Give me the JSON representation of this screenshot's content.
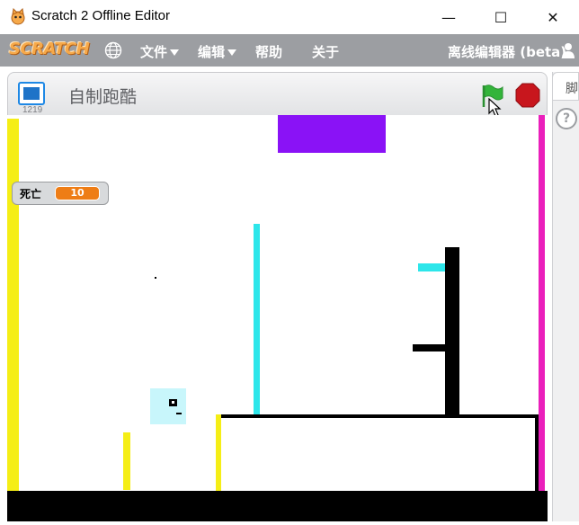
{
  "window": {
    "title": "Scratch 2 Offline Editor",
    "minimize_glyph": "—",
    "maximize_glyph": "☐",
    "close_glyph": "✕"
  },
  "menubar": {
    "logo": "SCRATCH",
    "globe_icon": "globe-icon",
    "items": [
      {
        "label": "文件",
        "has_caret": true
      },
      {
        "label": "编辑",
        "has_caret": true
      },
      {
        "label": "帮助",
        "has_caret": false
      },
      {
        "label": "关于",
        "has_caret": false
      }
    ],
    "offline_label": "离线编辑器 (beta)"
  },
  "stage_header": {
    "version": "1219",
    "project_title": "自制跑酷",
    "flag_icon": "green-flag-icon",
    "stop_icon": "stop-sign-icon"
  },
  "side_panel": {
    "tab_label": "脚本",
    "help_glyph": "?"
  },
  "monitor": {
    "label": "死亡",
    "value": "10"
  },
  "colors": {
    "menubar": "#9c9ea2",
    "flag": "#33b43a",
    "stop": "#c8161d",
    "monitor_value": "#ee7d16",
    "stage_yellow": "#f5ee16",
    "stage_magenta": "#ea1fbb",
    "stage_purple": "#8a12f6",
    "stage_cyan": "#2de6ea",
    "stage_black": "#000000",
    "sprite_light": "#c8f6fb"
  }
}
